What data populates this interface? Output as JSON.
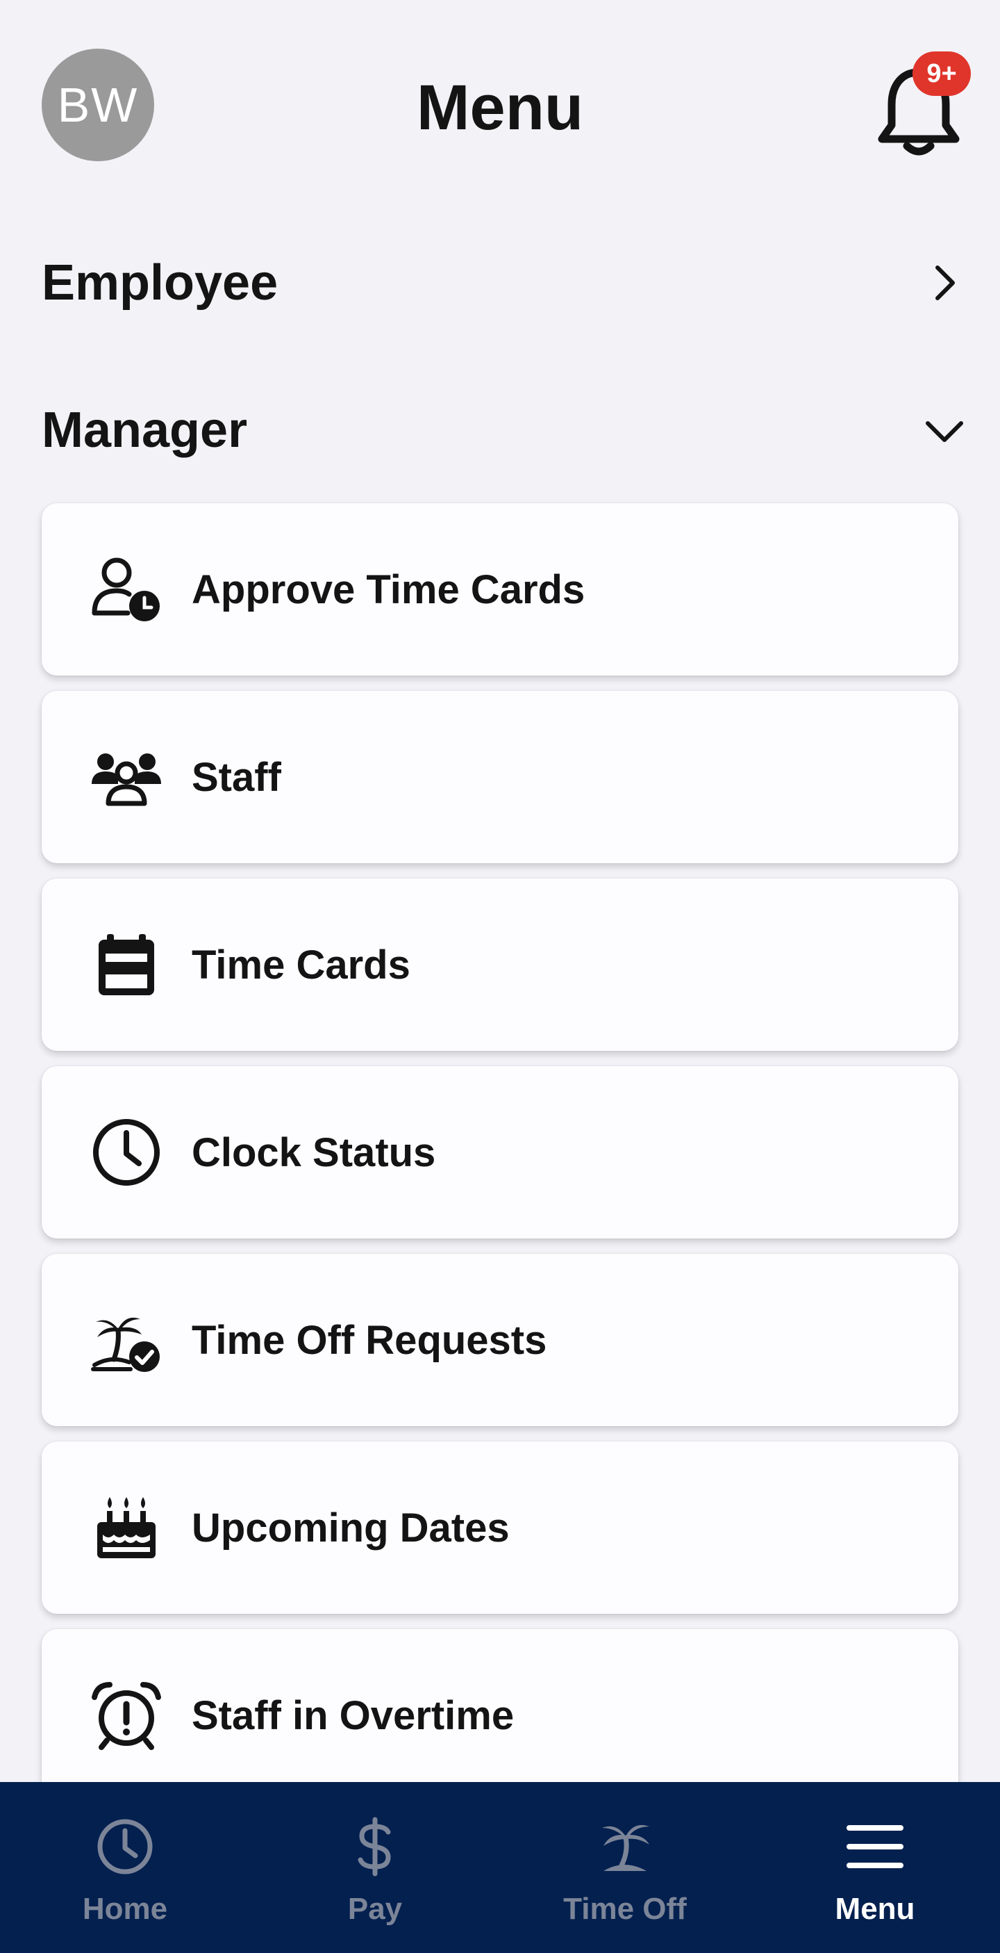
{
  "header": {
    "avatar_initials": "BW",
    "title": "Menu",
    "notification_badge": "9+"
  },
  "sections": {
    "employee": {
      "label": "Employee",
      "expanded": false
    },
    "manager": {
      "label": "Manager",
      "expanded": true
    }
  },
  "manager_items": [
    {
      "label": "Approve Time Cards",
      "icon": "user-clock-icon"
    },
    {
      "label": "Staff",
      "icon": "users-icon"
    },
    {
      "label": "Time Cards",
      "icon": "calendar-icon"
    },
    {
      "label": "Clock Status",
      "icon": "clock-icon"
    },
    {
      "label": "Time Off Requests",
      "icon": "palm-tree-check-icon"
    },
    {
      "label": "Upcoming Dates",
      "icon": "birthday-cake-icon"
    },
    {
      "label": "Staff in Overtime",
      "icon": "alarm-clock-alert-icon"
    }
  ],
  "bottom_nav": [
    {
      "label": "Home",
      "icon": "clock-icon",
      "active": false
    },
    {
      "label": "Pay",
      "icon": "dollar-icon",
      "active": false
    },
    {
      "label": "Time Off",
      "icon": "palm-tree-icon",
      "active": false
    },
    {
      "label": "Menu",
      "icon": "hamburger-menu-icon",
      "active": true
    }
  ],
  "colors": {
    "background": "#f3f2f7",
    "nav_background": "#03204f",
    "badge": "#e0352b",
    "avatar": "#9a9a9a",
    "nav_inactive": "#7c8598",
    "nav_active": "#ffffff"
  }
}
